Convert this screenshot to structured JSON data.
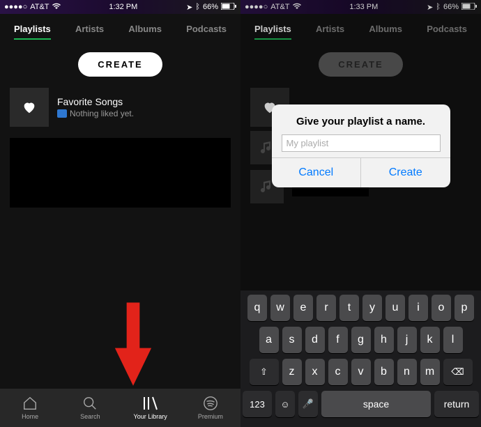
{
  "left": {
    "status": {
      "carrier": "AT&T",
      "time": "1:32 PM",
      "battery": "66%"
    },
    "tabs": {
      "playlists": "Playlists",
      "artists": "Artists",
      "albums": "Albums",
      "podcasts": "Podcasts"
    },
    "create_label": "CREATE",
    "favorite": {
      "title": "Favorite Songs",
      "subtitle": "Nothing liked yet."
    },
    "bottom": {
      "home": "Home",
      "search": "Search",
      "library": "Your Library",
      "premium": "Premium"
    }
  },
  "right": {
    "status": {
      "carrier": "AT&T",
      "time": "1:33 PM",
      "battery": "66%"
    },
    "tabs": {
      "playlists": "Playlists",
      "artists": "Artists",
      "albums": "Albums",
      "podcasts": "Podcasts"
    },
    "create_label": "CREATE",
    "dialog": {
      "title": "Give your playlist a name.",
      "placeholder": "My playlist",
      "cancel": "Cancel",
      "create": "Create"
    },
    "keyboard": {
      "row1": [
        "q",
        "w",
        "e",
        "r",
        "t",
        "y",
        "u",
        "i",
        "o",
        "p"
      ],
      "row2": [
        "a",
        "s",
        "d",
        "f",
        "g",
        "h",
        "j",
        "k",
        "l"
      ],
      "row3": [
        "z",
        "x",
        "c",
        "v",
        "b",
        "n",
        "m"
      ],
      "shift": "⇧",
      "backspace": "⌫",
      "numkey": "123",
      "emoji": "☺",
      "mic": "🎤",
      "space": "space",
      "return": "return"
    }
  }
}
